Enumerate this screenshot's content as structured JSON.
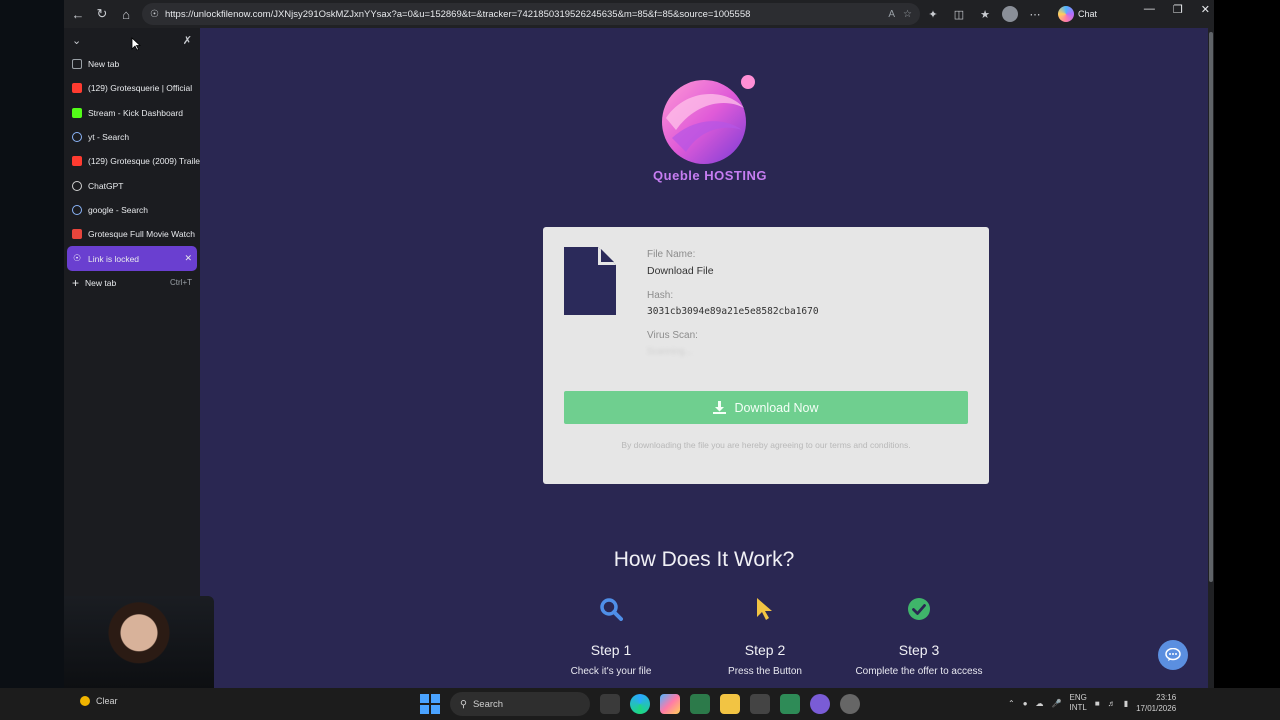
{
  "browser": {
    "url": "https://unlockfilenow.com/JXNjsy291OskMZJxnYYsax?a=0&u=152869&t=&tracker=7421850319526245635&m=85&f=85&source=1005558",
    "copilot_label": "Chat"
  },
  "tabs": [
    {
      "label": "New tab",
      "icon": "page-icon",
      "color": "#9aa0a6"
    },
    {
      "label": "(129) Grotesquerie | Official",
      "icon": "youtube-icon",
      "color": "#ff3b30"
    },
    {
      "label": "Stream - Kick Dashboard",
      "icon": "kick-icon",
      "color": "#53fc18"
    },
    {
      "label": "yt - Search",
      "icon": "search-icon",
      "color": "#8ab4f8"
    },
    {
      "label": "(129) Grotesque (2009) Traile",
      "icon": "youtube-icon",
      "color": "#ff3b30"
    },
    {
      "label": "ChatGPT",
      "icon": "chatgpt-icon",
      "color": "#d0d0d0"
    },
    {
      "label": "google - Search",
      "icon": "search-icon",
      "color": "#8ab4f8"
    },
    {
      "label": "Grotesque Full Movie Watch",
      "icon": "movie-site-icon",
      "color": "#e8453c"
    }
  ],
  "active_tab": {
    "label": "Link is locked"
  },
  "new_tab": {
    "label": "New tab",
    "shortcut": "Ctrl+T"
  },
  "page": {
    "brand": "Queble HOSTING",
    "file_name_label": "File Name:",
    "file_name": "Download File",
    "hash_label": "Hash:",
    "hash": "3031cb3094e89a21e5e8582cba1670",
    "virus_label": "Virus Scan:",
    "virus_value": "Scanning...",
    "download_label": "Download Now",
    "terms": "By downloading the file you are hereby agreeing to our terms and conditions.",
    "how_title": "How Does It Work?",
    "steps": [
      {
        "title": "Step 1",
        "desc": "Check it's your file",
        "icon": "search-icon"
      },
      {
        "title": "Step 2",
        "desc": "Press the Button",
        "icon": "pointer-icon"
      },
      {
        "title": "Step 3",
        "desc": "Complete the offer to access",
        "icon": "check-circle-icon"
      }
    ]
  },
  "taskbar": {
    "weather": "Clear",
    "search_placeholder": "Search",
    "lang_top": "ENG",
    "lang_bottom": "INTL",
    "time": "23:16",
    "date": "17/01/2026"
  },
  "colors": {
    "page_bg": "#2a2752",
    "accent_purple": "#6a3fd0",
    "download_green": "#6fcf8f",
    "brand_pink": "#c77df2"
  }
}
